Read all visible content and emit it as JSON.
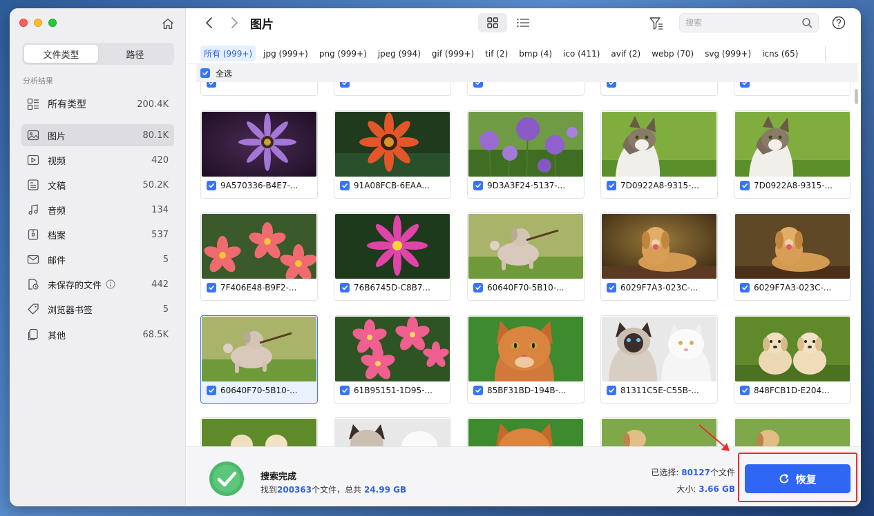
{
  "sidebar": {
    "tabs": [
      {
        "label": "文件类型",
        "active": true
      },
      {
        "label": "路径",
        "active": false
      }
    ],
    "section_label": "分析结果",
    "all_types": {
      "label": "所有类型",
      "count": "200.4K"
    },
    "categories": [
      {
        "label": "图片",
        "count": "80.1K",
        "icon": "image-icon",
        "active": true
      },
      {
        "label": "视频",
        "count": "420",
        "icon": "video-icon"
      },
      {
        "label": "文稿",
        "count": "50.2K",
        "icon": "document-icon"
      },
      {
        "label": "音频",
        "count": "134",
        "icon": "music-icon"
      },
      {
        "label": "档案",
        "count": "537",
        "icon": "archive-icon"
      },
      {
        "label": "邮件",
        "count": "5",
        "icon": "mail-icon"
      },
      {
        "label": "未保存的文件",
        "count": "442",
        "icon": "unsaved-file-icon",
        "info": true
      },
      {
        "label": "浏览器书签",
        "count": "5",
        "icon": "bookmark-tag-icon"
      },
      {
        "label": "其他",
        "count": "68.5K",
        "icon": "other-file-icon"
      }
    ]
  },
  "toolbar": {
    "title": "图片",
    "search_placeholder": "搜索"
  },
  "filters": [
    {
      "label": "所有 (999+)",
      "active": true
    },
    {
      "label": "jpg (999+)"
    },
    {
      "label": "png (999+)"
    },
    {
      "label": "jpeg (994)"
    },
    {
      "label": "gif (999+)"
    },
    {
      "label": "tif (2)"
    },
    {
      "label": "bmp (4)"
    },
    {
      "label": "ico (411)"
    },
    {
      "label": "avif (2)"
    },
    {
      "label": "webp (70)"
    },
    {
      "label": "svg (999+)"
    },
    {
      "label": "icns (65)"
    }
  ],
  "select_all": {
    "label": "全选",
    "checked": true
  },
  "files": {
    "row1": [
      {
        "name": "9A570336-B4E7-...",
        "thumb": "purple-flower"
      },
      {
        "name": "91A08FCB-6EAA...",
        "thumb": "orange-flower"
      },
      {
        "name": "9D3A3F24-5137-...",
        "thumb": "allium-flowers"
      },
      {
        "name": "7D0922A8-9315-...",
        "thumb": "tabby-cat"
      },
      {
        "name": "7D0922A8-9315-...",
        "thumb": "tabby-cat"
      }
    ],
    "row2": [
      {
        "name": "7F406E48-B9F2-...",
        "thumb": "plumeria-flowers"
      },
      {
        "name": "76B6745D-C8B7...",
        "thumb": "pink-flower"
      },
      {
        "name": "60640F70-5B10-...",
        "thumb": "running-dog"
      },
      {
        "name": "6029F7A3-023C-...",
        "thumb": "golden-retriever"
      },
      {
        "name": "6029F7A3-023C-...",
        "thumb": "golden-retriever"
      }
    ],
    "row3": [
      {
        "name": "60640F70-5B10-...",
        "thumb": "running-dog",
        "selected": true
      },
      {
        "name": "61B95151-1D95-...",
        "thumb": "pink-plumeria"
      },
      {
        "name": "85BF31BD-194B-...",
        "thumb": "ginger-cat"
      },
      {
        "name": "81311C5E-C55B-...",
        "thumb": "two-cats"
      },
      {
        "name": "848FCB1D-E204...",
        "thumb": "two-puppies"
      }
    ]
  },
  "footer": {
    "status_title": "搜索完成",
    "found_prefix": "找到",
    "found_count": "200363",
    "found_mid": "个文件，总共",
    "found_size": "24.99 GB",
    "selected_label": "已选择:",
    "selected_count": "80127",
    "selected_suffix": "个文件",
    "size_label": "大小:",
    "size_value": "3.66 GB",
    "recover_label": "恢复"
  },
  "colors": {
    "accent": "#2f66f3",
    "highlight_box": "#f02a2a"
  }
}
